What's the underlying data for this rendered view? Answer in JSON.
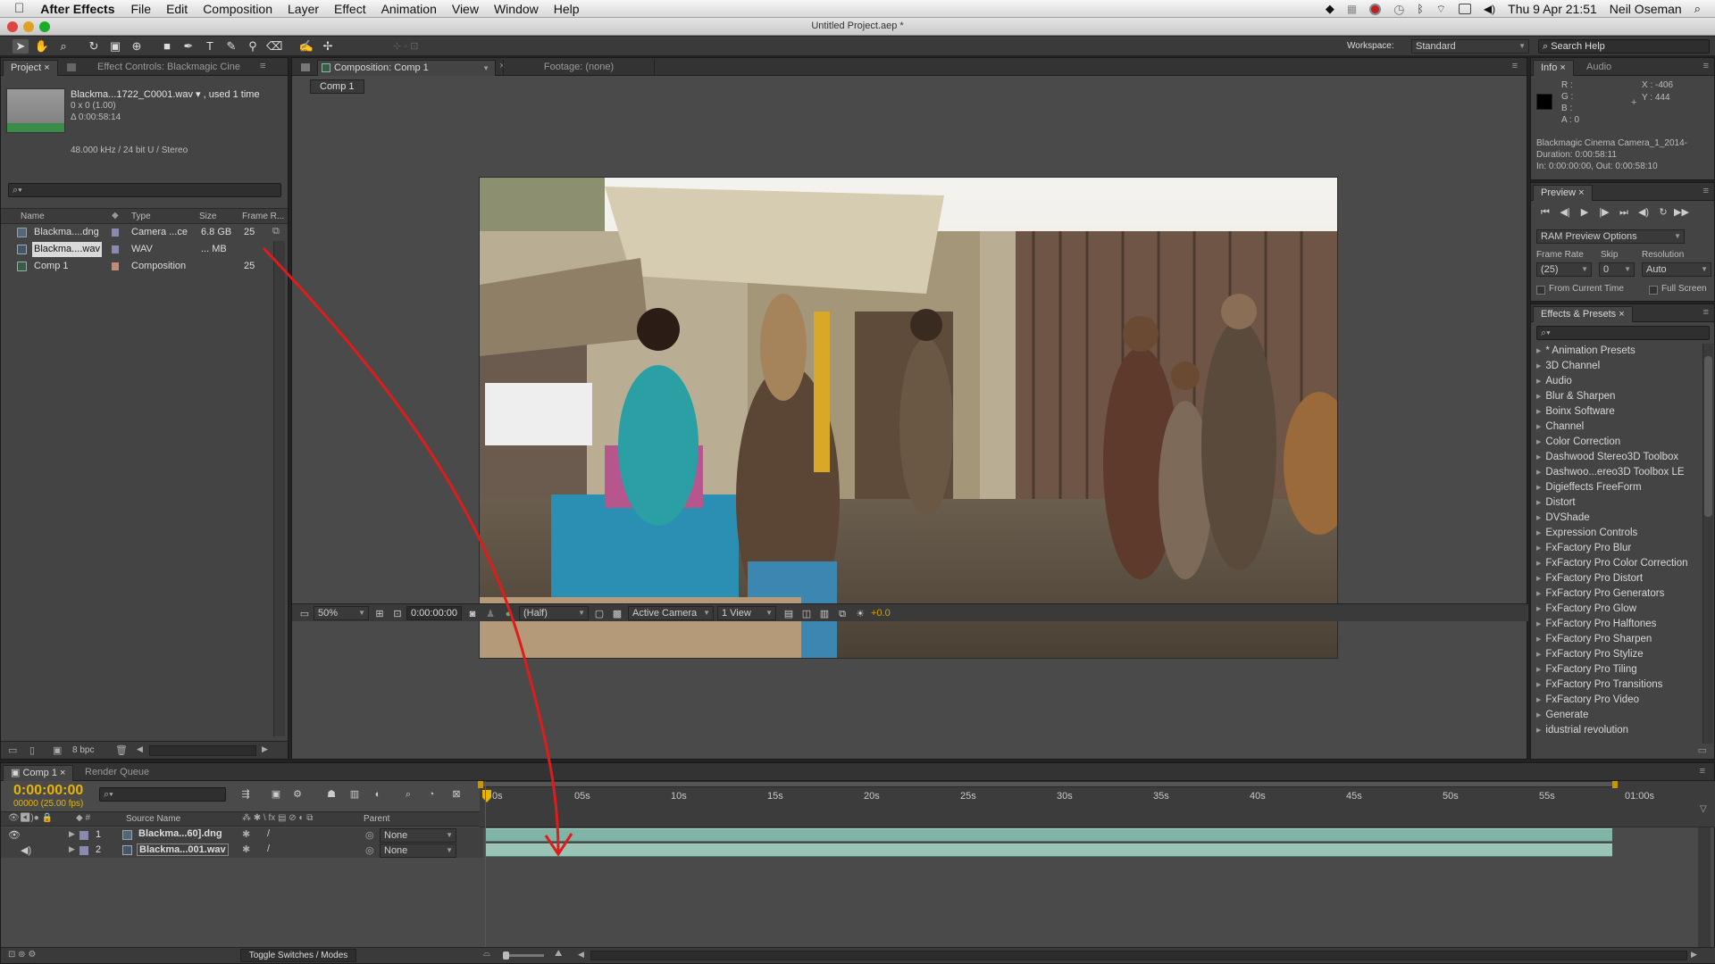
{
  "menubar": {
    "apple": "",
    "app": "After Effects",
    "items": [
      "File",
      "Edit",
      "Composition",
      "Layer",
      "Effect",
      "Animation",
      "View",
      "Window",
      "Help"
    ],
    "clock": "Thu 9 Apr  21:51",
    "user": "Neil Oseman"
  },
  "window": {
    "title": "Untitled Project.aep *"
  },
  "workspace": {
    "label": "Workspace:",
    "value": "Standard",
    "search_placeholder": "Search Help"
  },
  "project": {
    "tab_project": "Project",
    "tab_effect": "Effect Controls: Blackmagic Cine",
    "file_name": "Blackma...1722_C0001.wav ▾ , used 1 time",
    "dims": "0 x 0 (1.00)",
    "duration": "Δ 0:00:58:14",
    "audio_info": "48.000 kHz / 24 bit U / Stereo",
    "columns": [
      "Name",
      "Type",
      "Size",
      "Frame R..."
    ],
    "rows": [
      {
        "name": "Blackma....dng",
        "type": "Camera ...ce",
        "size": "6.8 GB",
        "fps": "25",
        "label_color": "#8a8ab0"
      },
      {
        "name": "Blackma....wav",
        "type": "WAV",
        "size": "... MB",
        "fps": "",
        "label_color": "#8a8ab0"
      },
      {
        "name": "Comp 1",
        "type": "Composition",
        "size": "",
        "fps": "25",
        "label_color": "#c08c7a"
      }
    ],
    "bpc": "8 bpc"
  },
  "composition": {
    "tab_label": "Composition: Comp 1",
    "footage_label": "Footage: (none)",
    "sub_tab": "Comp 1",
    "zoom": "50%",
    "timecode": "0:00:00:00",
    "resolution": "(Half)",
    "camera": "Active Camera",
    "views": "1 View",
    "exposure": "+0.0"
  },
  "info": {
    "tab_info": "Info",
    "tab_audio": "Audio",
    "r": "R :",
    "g": "G :",
    "b": "B :",
    "a": "A : 0",
    "x": "X : -406",
    "y": "Y : 444",
    "clip_name": "Blackmagic Cinema Camera_1_2014-",
    "duration": "Duration: 0:00:58:11",
    "inout": "In: 0:00:00:00, Out: 0:00:58:10"
  },
  "preview": {
    "tab": "Preview",
    "ram": "RAM Preview Options",
    "frame_rate_label": "Frame Rate",
    "skip_label": "Skip",
    "resolution_label": "Resolution",
    "frame_rate": "(25)",
    "skip": "0",
    "resolution": "Auto",
    "from_current": "From Current Time",
    "full_screen": "Full Screen"
  },
  "effects": {
    "tab": "Effects & Presets",
    "items": [
      "* Animation Presets",
      "3D Channel",
      "Audio",
      "Blur & Sharpen",
      "Boinx Software",
      "Channel",
      "Color Correction",
      "Dashwood Stereo3D Toolbox",
      "Dashwoo...ereo3D Toolbox LE",
      "Digieffects FreeForm",
      "Distort",
      "DVShade",
      "Expression Controls",
      "FxFactory Pro Blur",
      "FxFactory Pro Color Correction",
      "FxFactory Pro Distort",
      "FxFactory Pro Generators",
      "FxFactory Pro Glow",
      "FxFactory Pro Halftones",
      "FxFactory Pro Sharpen",
      "FxFactory Pro Stylize",
      "FxFactory Pro Tiling",
      "FxFactory Pro Transitions",
      "FxFactory Pro Video",
      "Generate",
      "idustrial revolution"
    ]
  },
  "timeline": {
    "tab": "Comp 1",
    "tab_render": "Render Queue",
    "timecode": "0:00:00:00",
    "fps": "00000 (25.00 fps)",
    "col_source": "Source Name",
    "col_parent": "Parent",
    "ruler": [
      "0s",
      "05s",
      "10s",
      "15s",
      "20s",
      "25s",
      "30s",
      "35s",
      "40s",
      "45s",
      "50s",
      "55s",
      "01:00s"
    ],
    "layers": [
      {
        "num": "1",
        "name": "Blackma...60].dng",
        "parent": "None"
      },
      {
        "num": "2",
        "name": "Blackma...001.wav",
        "parent": "None"
      }
    ],
    "toggle": "Toggle Switches / Modes"
  },
  "colors": {
    "accent_timecode": "#e8b400",
    "annotation_arrow": "#e01b1b",
    "layer_bar": "#7fb4a6"
  }
}
